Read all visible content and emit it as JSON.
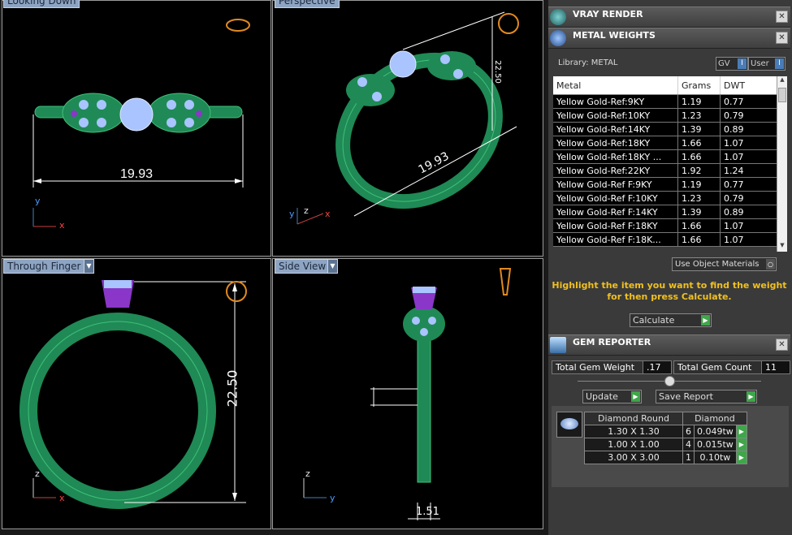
{
  "viewports": {
    "top_left": {
      "title": "Looking Down",
      "dimension": "19.93",
      "axes": [
        "y",
        "x"
      ]
    },
    "top_right": {
      "title": "Perspective",
      "dimension_length": "19.93",
      "dimension_height": "22.50",
      "axes": [
        "z",
        "y",
        "x"
      ]
    },
    "bottom_left": {
      "title": "Through Finger",
      "dimension": "22.50",
      "axes": [
        "z",
        "x"
      ]
    },
    "bottom_right": {
      "title": "Side View",
      "dimension": "1.51",
      "axes": [
        "z",
        "y"
      ]
    }
  },
  "vray": {
    "title": "VRAY RENDER",
    "close": "✕"
  },
  "metal": {
    "title": "METAL WEIGHTS",
    "close": "✕",
    "library": "Library: METAL",
    "gv": "GV",
    "user": "User",
    "headers": [
      "Metal",
      "Grams",
      "DWT"
    ],
    "rows": [
      [
        "Yellow Gold-Ref:9KY",
        "1.19",
        "0.77"
      ],
      [
        "Yellow Gold-Ref:10KY",
        "1.23",
        "0.79"
      ],
      [
        "Yellow Gold-Ref:14KY",
        "1.39",
        "0.89"
      ],
      [
        "Yellow Gold-Ref:18KY",
        "1.66",
        "1.07"
      ],
      [
        "Yellow Gold-Ref:18KY ...",
        "1.66",
        "1.07"
      ],
      [
        "Yellow Gold-Ref:22KY",
        "1.92",
        "1.24"
      ],
      [
        "Yellow Gold-Ref F:9KY",
        "1.19",
        "0.77"
      ],
      [
        "Yellow Gold-Ref F:10KY",
        "1.23",
        "0.79"
      ],
      [
        "Yellow Gold-Ref F:14KY",
        "1.39",
        "0.89"
      ],
      [
        "Yellow Gold-Ref F:18KY",
        "1.66",
        "1.07"
      ],
      [
        "Yellow Gold-Ref F:18K...",
        "1.66",
        "1.07"
      ]
    ],
    "use_object_materials": "Use Object Materials",
    "hint_line1": "Highlight the item you want to find the weight",
    "hint_line2": "for then press Calculate.",
    "calculate": "Calculate"
  },
  "gem": {
    "title": "GEM REPORTER",
    "close": "✕",
    "total_weight_label": "Total Gem Weight",
    "total_weight": ".17",
    "total_count_label": "Total Gem Count",
    "total_count": "11",
    "update": "Update",
    "save_report": "Save Report",
    "headers": [
      "Diamond Round",
      "Diamond"
    ],
    "rows": [
      {
        "size": "1.30 X 1.30",
        "count": "6",
        "weight": "0.049tw"
      },
      {
        "size": "1.00 X 1.00",
        "count": "4",
        "weight": "0.015tw"
      },
      {
        "size": "3.00 X 3.00",
        "count": "1",
        "weight": "0.10tw"
      }
    ]
  },
  "colors": {
    "band": "#1f8a55",
    "gem": "#a9c4ff",
    "prong": "#8a36c8",
    "accent": "#f0c020"
  }
}
